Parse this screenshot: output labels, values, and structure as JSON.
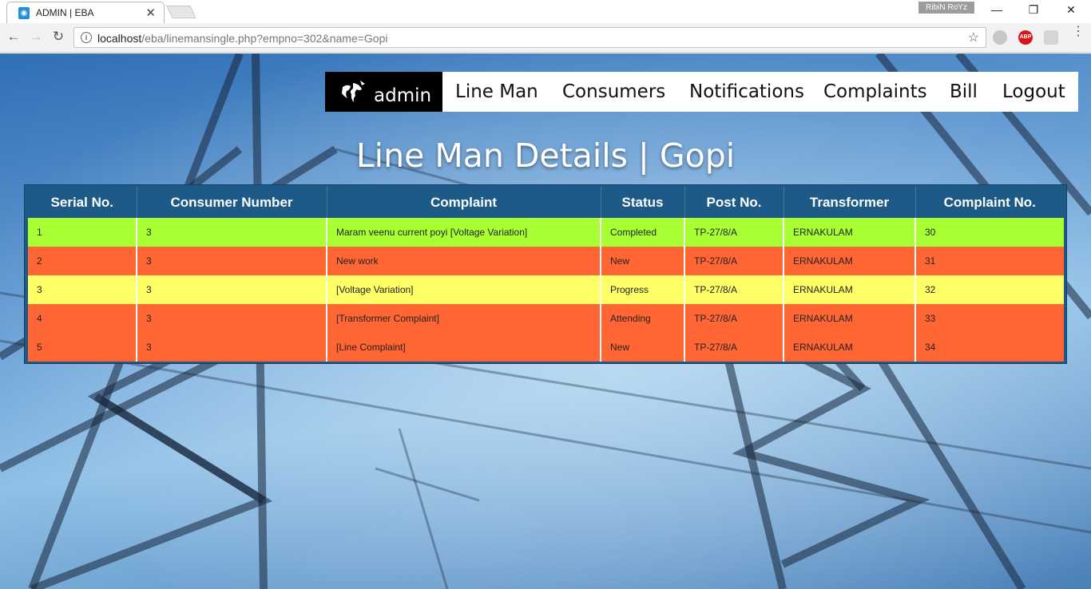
{
  "browser": {
    "tab_title": "ADMIN | EBA",
    "profile_name": "RibiN RoYz",
    "url_host": "localhost",
    "url_path": "/eba/linemansingle.php?empno=302&name=Gopi",
    "extension_abp": "ABP"
  },
  "navbar": {
    "brand": "admin",
    "items": [
      "Line Man",
      "Consumers",
      "Notifications",
      "Complaints",
      "Bill",
      "Logout"
    ]
  },
  "page_title": "Line Man Details | Gopi",
  "table": {
    "headers": [
      "Serial No.",
      "Consumer Number",
      "Complaint",
      "Status",
      "Post No.",
      "Transformer",
      "Complaint No."
    ],
    "rows": [
      {
        "color": "#a8ff32",
        "cells": [
          "1",
          "3",
          "Maram veenu current poyi [Voltage Variation]",
          "Completed",
          "TP-27/8/A",
          "ERNAKULAM",
          "30"
        ]
      },
      {
        "color": "#ff6633",
        "cells": [
          "2",
          "3",
          "New work",
          "New",
          "TP-27/8/A",
          "ERNAKULAM",
          "31"
        ]
      },
      {
        "color": "#ffff66",
        "cells": [
          "3",
          "3",
          "[Voltage Variation]",
          "Progress",
          "TP-27/8/A",
          "ERNAKULAM",
          "32"
        ]
      },
      {
        "color": "#ff6633",
        "cells": [
          "4",
          "3",
          "[Transformer Complaint]",
          "Attending",
          "TP-27/8/A",
          "ERNAKULAM",
          "33"
        ]
      },
      {
        "color": "#ff6633",
        "cells": [
          "5",
          "3",
          "[Line Complaint]",
          "New",
          "TP-27/8/A",
          "ERNAKULAM",
          "34"
        ]
      }
    ]
  }
}
